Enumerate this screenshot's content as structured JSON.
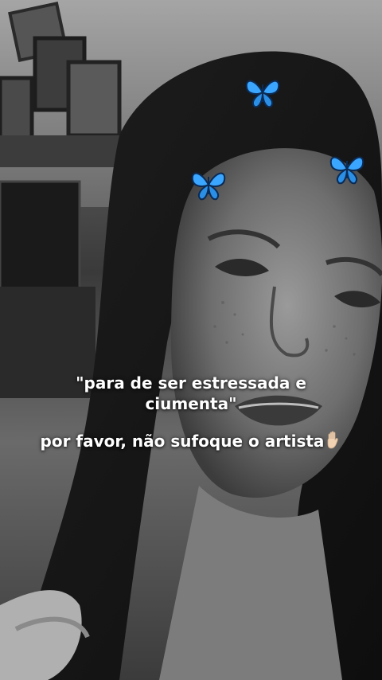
{
  "story": {
    "caption_quote": "\"para de ser estressada e ciumenta\"",
    "caption_plea": "por favor, não sufoque o artista",
    "emoji": "raised-hand-icon",
    "photo": "grayscale-selfie-woman-long-hair",
    "filter": "black-and-white-with-blue-butterflies"
  },
  "colors": {
    "caption_text": "#ffffff",
    "butterfly_blue": "#3aa6ff",
    "butterfly_dark": "#0b2b55",
    "hand_skin": "#f1d2b3"
  }
}
